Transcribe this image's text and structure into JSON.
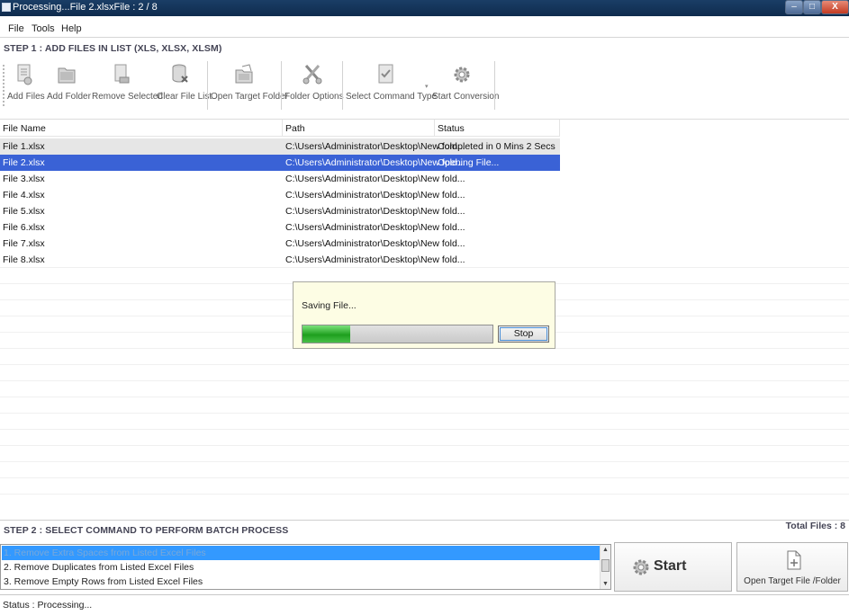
{
  "window": {
    "title": "Processing...File 2.xlsxFile : 2 / 8",
    "controls": {
      "minimize": "–",
      "maximize": "□",
      "close": "X"
    }
  },
  "menu": {
    "items": [
      "File",
      "Tools",
      "Help"
    ]
  },
  "step1": {
    "label": "STEP 1 : ADD FILES IN LIST (XLS, XLSX, XLSM)"
  },
  "toolbar": {
    "add_files": "Add Files",
    "add_folder": "Add Folder",
    "remove_selected": "Remove Selected",
    "clear_file_list": "Clear File List",
    "open_target_folder": "Open Target Folder",
    "folder_options": "Folder Options",
    "select_command_type": "Select Command Type",
    "start_conversion": "Start Conversion"
  },
  "grid": {
    "columns": [
      "File Name",
      "Path",
      "Status"
    ],
    "rows": [
      {
        "name": "File 1.xlsx",
        "path": "C:\\Users\\Administrator\\Desktop\\New fold...",
        "status": "Completed in 0 Mins 2 Secs"
      },
      {
        "name": "File 2.xlsx",
        "path": "C:\\Users\\Administrator\\Desktop\\New fold...",
        "status": "Opening File..."
      },
      {
        "name": "File 3.xlsx",
        "path": "C:\\Users\\Administrator\\Desktop\\New fold...",
        "status": ""
      },
      {
        "name": "File 4.xlsx",
        "path": "C:\\Users\\Administrator\\Desktop\\New fold...",
        "status": ""
      },
      {
        "name": "File 5.xlsx",
        "path": "C:\\Users\\Administrator\\Desktop\\New fold...",
        "status": ""
      },
      {
        "name": "File 6.xlsx",
        "path": "C:\\Users\\Administrator\\Desktop\\New fold...",
        "status": ""
      },
      {
        "name": "File 7.xlsx",
        "path": "C:\\Users\\Administrator\\Desktop\\New fold...",
        "status": ""
      },
      {
        "name": "File 8.xlsx",
        "path": "C:\\Users\\Administrator\\Desktop\\New fold...",
        "status": ""
      }
    ]
  },
  "progress_dialog": {
    "message": "Saving File...",
    "progress_fraction": 0.25,
    "stop_label": "Stop"
  },
  "step2": {
    "label": "STEP 2 : SELECT COMMAND TO PERFORM BATCH PROCESS",
    "total_files": "Total Files : 8",
    "commands": [
      "1. Remove Extra Spaces from Listed Excel Files",
      "2. Remove Duplicates from Listed Excel Files",
      "3. Remove Empty Rows from Listed Excel Files"
    ],
    "start_label": "Start",
    "open_target_label": "Open Target File /Folder"
  },
  "status": {
    "text": "Status  :  Processing..."
  },
  "colors": {
    "selected_row": "#3a62d6",
    "progress": "#1e9f1e",
    "dialog_bg": "#fdfde4"
  }
}
